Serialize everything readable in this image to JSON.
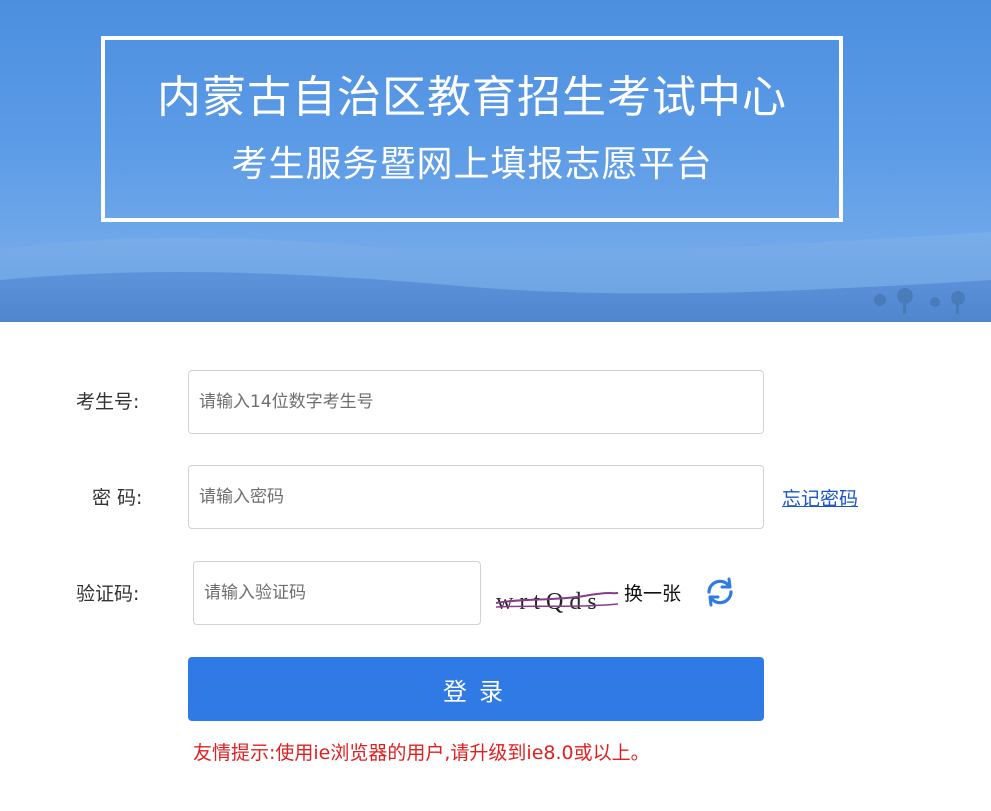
{
  "header": {
    "title_line1": "内蒙古自治区教育招生考试中心",
    "title_line2": "考生服务暨网上填报志愿平台",
    "banner_color": "#5c9be6"
  },
  "form": {
    "exam_id": {
      "label": "考生号:",
      "placeholder": "请输入14位数字考生号",
      "value": ""
    },
    "password": {
      "label": "密 码:",
      "placeholder": "请输入密码",
      "value": "",
      "forgot_link": "忘记密码"
    },
    "captcha": {
      "label": "验证码:",
      "placeholder": "请输入验证码",
      "value": "",
      "image_text": "wrtQds",
      "refresh_label": "换一张"
    },
    "login_button": "登录",
    "tip": "友情提示:使用ie浏览器的用户,请升级到ie8.0或以上。"
  },
  "colors": {
    "accent": "#2f7ae5",
    "link": "#1a56c9",
    "warning": "#e02020"
  }
}
